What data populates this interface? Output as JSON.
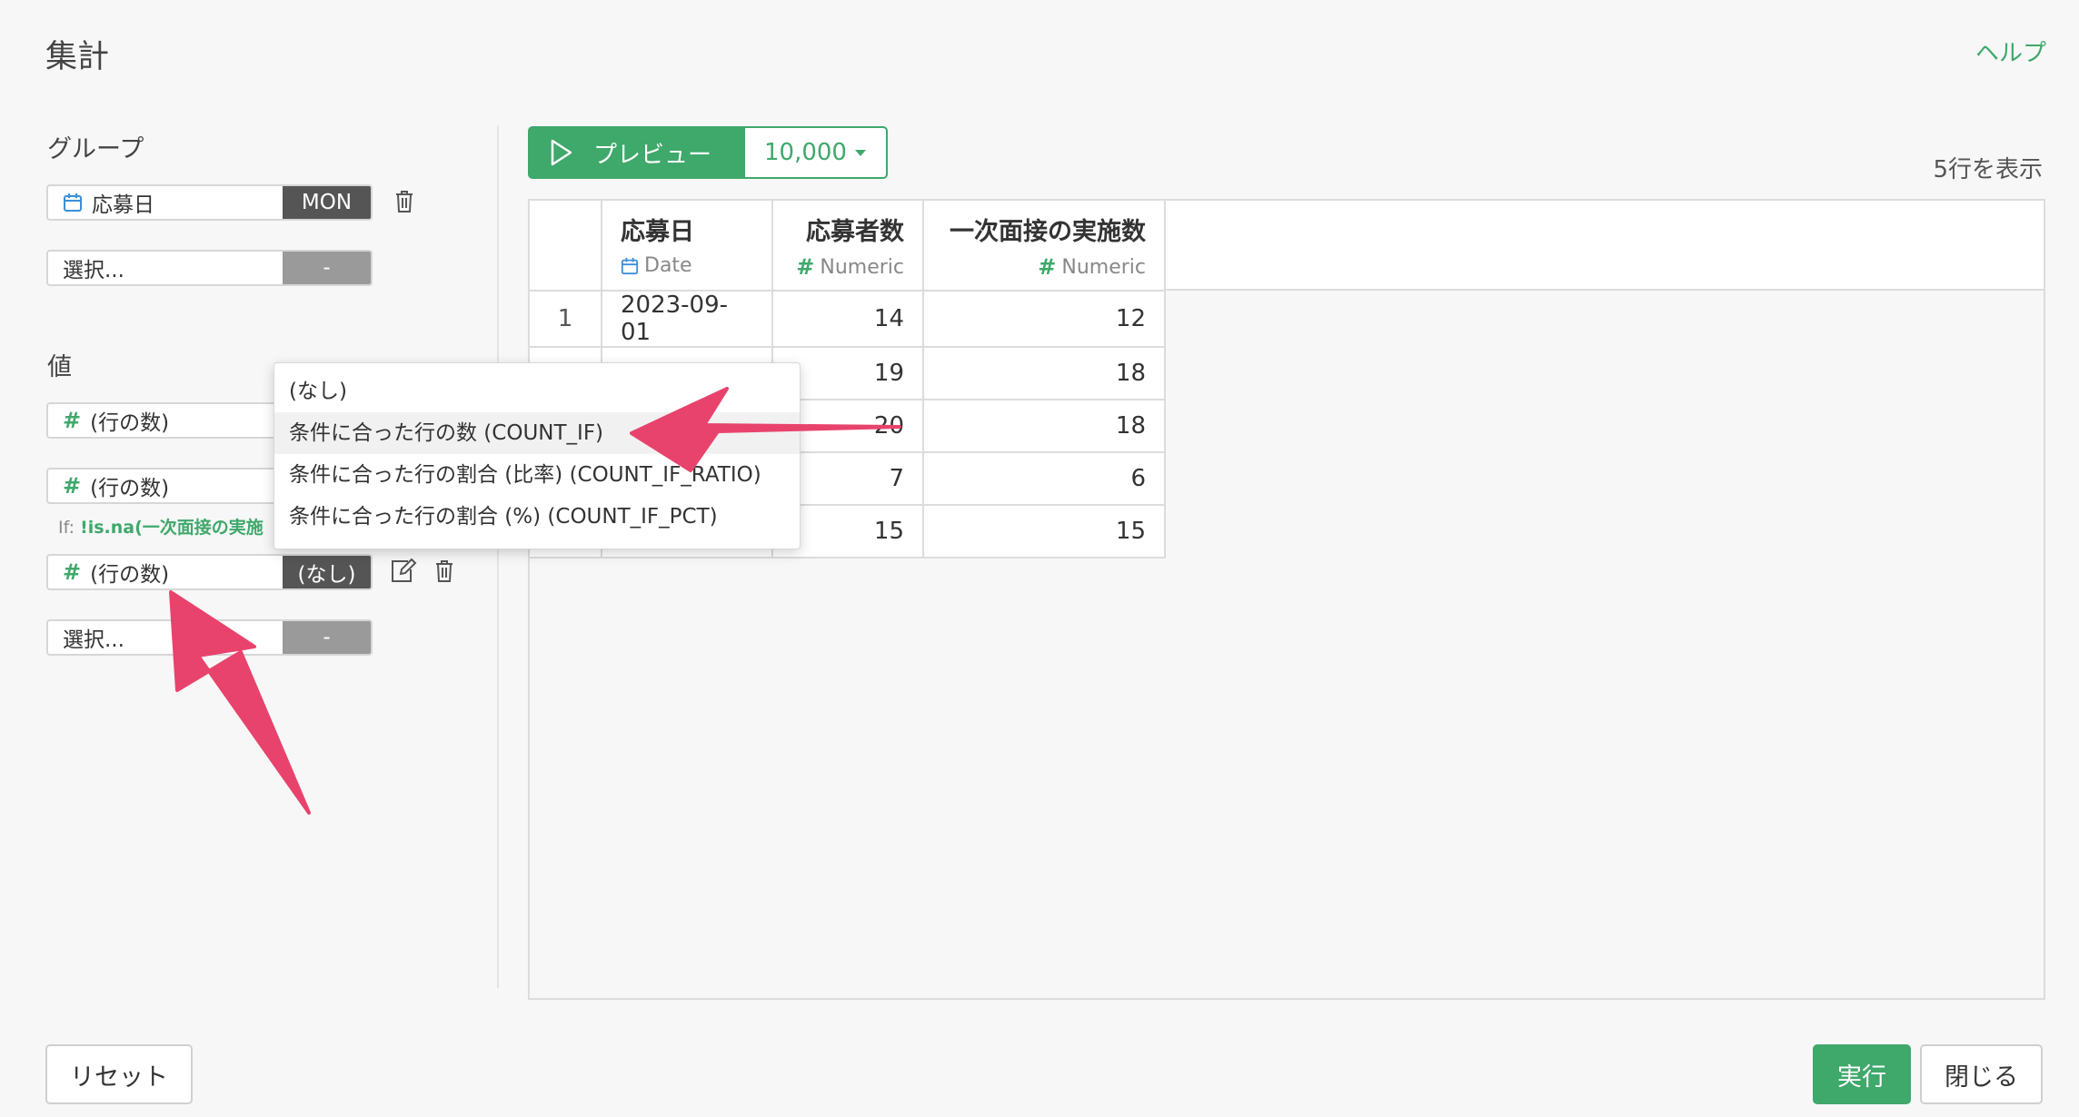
{
  "header": {
    "title": "集計",
    "help": "ヘルプ"
  },
  "group": {
    "label": "グループ",
    "items": [
      {
        "name": "応募日",
        "agg": "MON"
      },
      {
        "name": "選択...",
        "agg": "-"
      }
    ]
  },
  "values": {
    "label": "値",
    "items": [
      {
        "name": "(行の数)"
      },
      {
        "name": "(行の数)",
        "if_prefix": "If: ",
        "if_expr": "!is.na(一次面接の実施"
      },
      {
        "name": "(行の数)",
        "agg": "(なし)"
      },
      {
        "name": "選択...",
        "agg": "-"
      }
    ]
  },
  "dropdown": {
    "options": [
      "(なし)",
      "条件に合った行の数 (COUNT_IF)",
      "条件に合った行の割合 (比率) (COUNT_IF_RATIO)",
      "条件に合った行の割合 (%) (COUNT_IF_PCT)"
    ],
    "highlighted_index": 1
  },
  "preview": {
    "button": "プレビュー",
    "rows": "10,000",
    "row_count": "5行を表示"
  },
  "table": {
    "columns": [
      {
        "name": "応募日",
        "type": "Date",
        "type_icon": "calendar-icon"
      },
      {
        "name": "応募者数",
        "type": "Numeric",
        "type_icon": "hash-icon"
      },
      {
        "name": "一次面接の実施数",
        "type": "Numeric",
        "type_icon": "hash-icon"
      }
    ],
    "rows": [
      {
        "index": "1",
        "date": "2023-09-01",
        "applicants": "14",
        "interviews": "12"
      },
      {
        "index": "",
        "date": "",
        "applicants": "19",
        "interviews": "18"
      },
      {
        "index": "",
        "date": "",
        "applicants": "20",
        "interviews": "18"
      },
      {
        "index": "",
        "date": "",
        "applicants": "7",
        "interviews": "6"
      },
      {
        "index": "",
        "date": "",
        "applicants": "15",
        "interviews": "15"
      }
    ]
  },
  "footer": {
    "reset": "リセット",
    "run": "実行",
    "close": "閉じる"
  },
  "colors": {
    "accent": "#3fa86b",
    "arrow": "#e8436c"
  }
}
